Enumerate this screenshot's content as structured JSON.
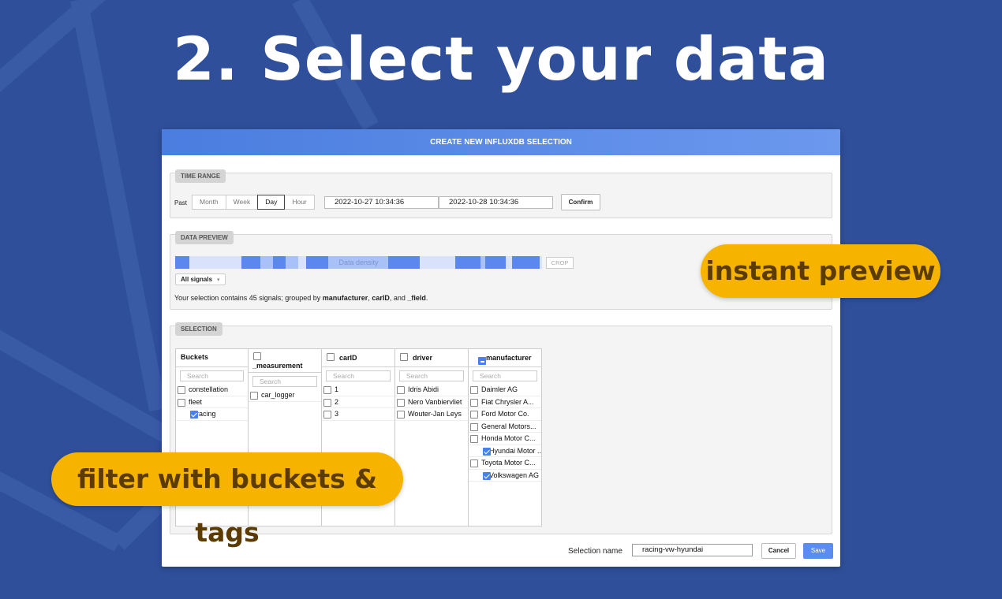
{
  "headline": "2. Select your data",
  "dialog": {
    "title": "CREATE NEW INFLUXDB SELECTION",
    "time_range": {
      "section_label": "TIME RANGE",
      "past_label": "Past",
      "periods": [
        "Month",
        "Week",
        "Day",
        "Hour"
      ],
      "active_period": "Day",
      "start": "2022-10-27 10:34:36",
      "end": "2022-10-28 10:34:36",
      "confirm_label": "Confirm"
    },
    "data_preview": {
      "section_label": "DATA PREVIEW",
      "density_label": "Data density",
      "crop_label": "CROP",
      "signals_dropdown": "All signals",
      "summary_prefix": "Your selection contains 45 signals; grouped by ",
      "summary_group1": "manufacturer",
      "summary_sep1": ", ",
      "summary_group2": "carID",
      "summary_sep2": ", and ",
      "summary_group3": "_field",
      "summary_suffix": "."
    },
    "selection": {
      "section_label": "SELECTION",
      "columns": {
        "buckets": {
          "header": "Buckets",
          "search_placeholder": "Search",
          "items": [
            {
              "label": "constellation",
              "checked": false
            },
            {
              "label": "fleet",
              "checked": false
            },
            {
              "label": "racing",
              "checked": true
            }
          ]
        },
        "measurement": {
          "header": "_measurement",
          "search_placeholder": "Search",
          "items": [
            {
              "label": "car_logger",
              "checked": false
            }
          ]
        },
        "carid": {
          "header": "carID",
          "search_placeholder": "Search",
          "items": [
            {
              "label": "1",
              "checked": false
            },
            {
              "label": "2",
              "checked": false
            },
            {
              "label": "3",
              "checked": false
            }
          ]
        },
        "driver": {
          "header": "driver",
          "search_placeholder": "Search",
          "items": [
            {
              "label": "Idris Abidi",
              "checked": false
            },
            {
              "label": "Nero Vanbiervliet",
              "checked": false
            },
            {
              "label": "Wouter-Jan Leys",
              "checked": false
            }
          ]
        },
        "manufacturer": {
          "header": "manufacturer",
          "search_placeholder": "Search",
          "items": [
            {
              "label": "Daimler AG",
              "checked": false
            },
            {
              "label": "Fiat Chrysler A...",
              "checked": false
            },
            {
              "label": "Ford Motor Co.",
              "checked": false
            },
            {
              "label": "General Motors...",
              "checked": false
            },
            {
              "label": "Honda Motor C...",
              "checked": false
            },
            {
              "label": "Hyundai Motor ...",
              "checked": true
            },
            {
              "label": "Toyota Motor C...",
              "checked": false
            },
            {
              "label": "Volkswagen AG",
              "checked": true
            }
          ]
        }
      }
    },
    "footer": {
      "name_label": "Selection name",
      "name_value": "racing-vw-hyundai",
      "cancel_label": "Cancel",
      "save_label": "Save"
    }
  },
  "callouts": {
    "preview": "instant preview",
    "filter": "filter with buckets & tags"
  },
  "colors": {
    "background": "#2f4f9a",
    "accent": "#4a80ee",
    "callout": "#f6b400"
  }
}
